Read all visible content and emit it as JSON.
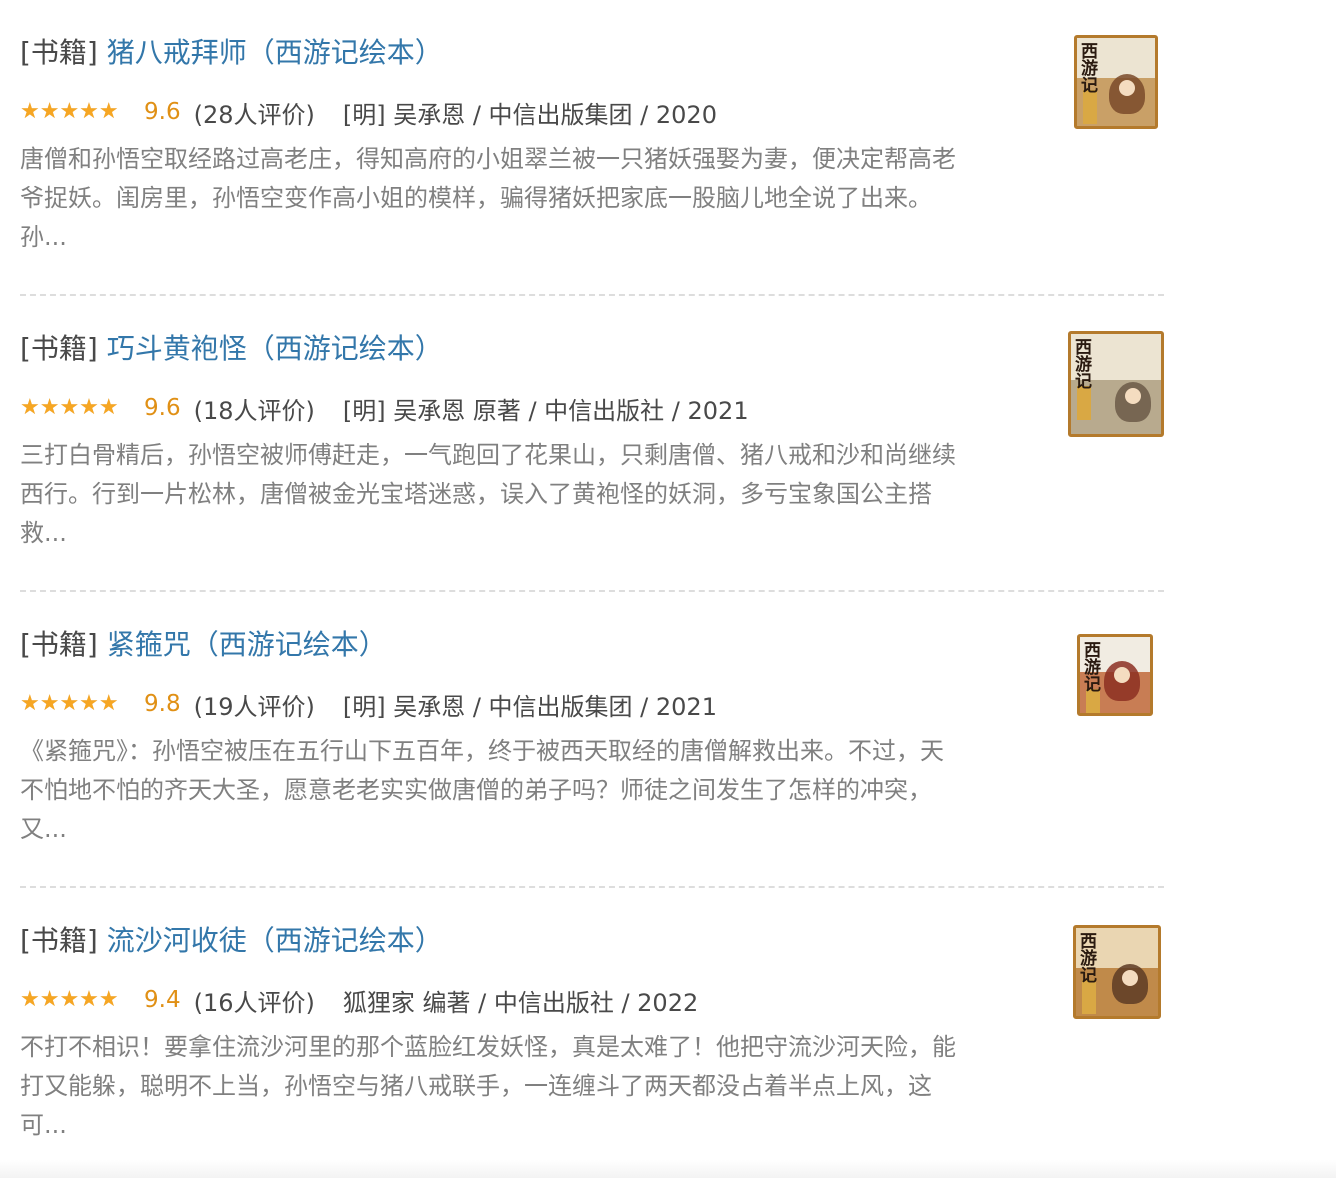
{
  "books": [
    {
      "tag": "[书籍]",
      "title": "猪八戒拜师（西游记绘本）",
      "stars_fill": 1.0,
      "rating": "9.6",
      "count": "(28人评价)",
      "pub": "[明] 吴承恩 / 中信出版集团 / 2020",
      "desc": [
        "唐僧和孙悟空取经路过高老庄，得知高府的小姐翠兰被一只猪妖强娶为妻，便决定帮高老",
        "爷捉妖。闺房里，孙悟空变作高小姐的模样，骗得猪妖把家底一股脑儿地全说了出来。",
        "孙..."
      ],
      "cover_title": "西游记"
    },
    {
      "tag": "[书籍]",
      "title": "巧斗黄袍怪（西游记绘本）",
      "stars_fill": 1.0,
      "rating": "9.6",
      "count": "(18人评价)",
      "pub": "[明] 吴承恩 原著 / 中信出版社 / 2021",
      "desc": [
        "三打白骨精后，孙悟空被师傅赶走，一气跑回了花果山，只剩唐僧、猪八戒和沙和尚继续",
        "西行。行到一片松林，唐僧被金光宝塔迷惑，误入了黄袍怪的妖洞，多亏宝象国公主搭",
        "救..."
      ],
      "cover_title": "西游记"
    },
    {
      "tag": "[书籍]",
      "title": "紧箍咒（西游记绘本）",
      "stars_fill": 1.0,
      "rating": "9.8",
      "count": "(19人评价)",
      "pub": "[明] 吴承恩 / 中信出版集团 / 2021",
      "desc": [
        "《紧箍咒》：孙悟空被压在五行山下五百年，终于被西天取经的唐僧解救出来。不过，天",
        "不怕地不怕的齐天大圣，愿意老老实实做唐僧的弟子吗？师徒之间发生了怎样的冲突，",
        "又..."
      ],
      "cover_title": "西游记"
    },
    {
      "tag": "[书籍]",
      "title": "流沙河收徒（西游记绘本）",
      "stars_fill": 0.9,
      "rating": "9.4",
      "count": "(16人评价)",
      "pub": "狐狸家 编著 / 中信出版社 / 2022",
      "desc": [
        "不打不相识！要拿住流沙河里的那个蓝脸红发妖怪，真是太难了！他把守流沙河天险，能",
        "打又能躲，聪明不上当，孙悟空与猪八戒联手，一连缠斗了两天都没占着半点上风，这",
        "可..."
      ],
      "cover_title": "西游记"
    }
  ],
  "colors": {
    "link": "#3377aa",
    "star": "#f6a623",
    "rating": "#e09015",
    "desc": "#808080",
    "text": "#494949"
  },
  "icons": {
    "star": "star-icon"
  }
}
